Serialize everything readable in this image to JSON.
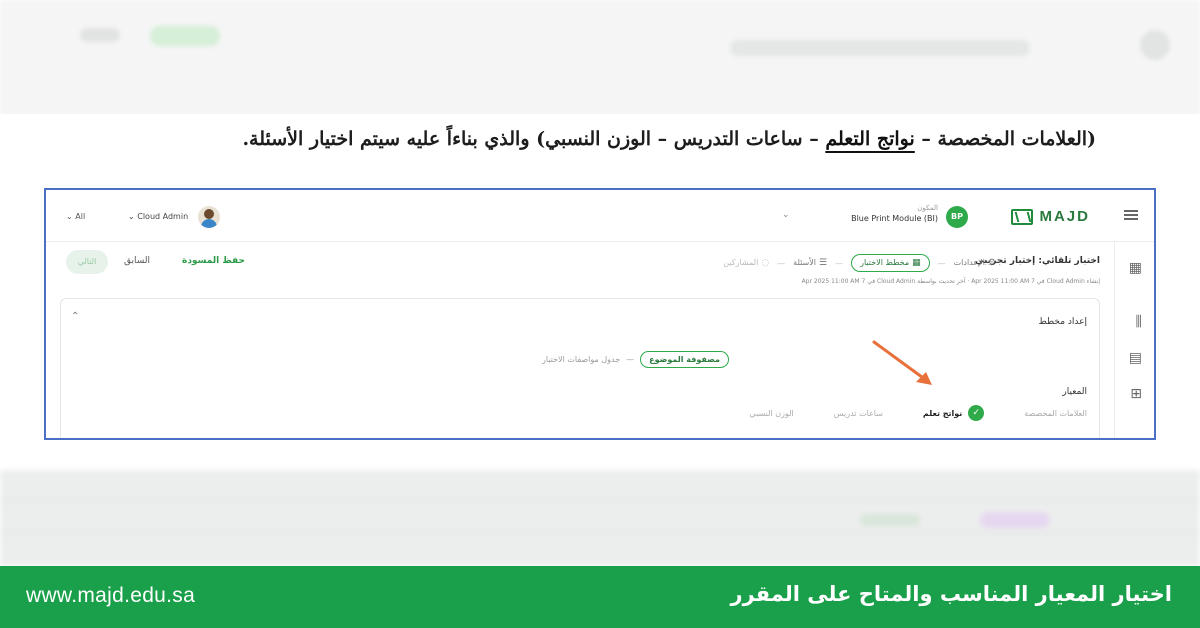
{
  "instruction": {
    "open": "(العلامات المخصصة – ",
    "highlight": "نواتج التعلم",
    "rest": " – ساعات التدريس – الوزن النسبي) والذي بناءاً عليه سيتم اختيار الأسئلة."
  },
  "topbar": {
    "logo_text": "MAJD",
    "module_avatar": "BP",
    "module_label": "المكون",
    "module_value": "Blue Print Module (BI)",
    "user_name": "Cloud Admin",
    "language": "All"
  },
  "exam": {
    "title": "اختبار تلقائي: إختبار تجريبي",
    "steps": [
      {
        "label": "الإعدادات",
        "icon": "gear-icon"
      },
      {
        "label": "مخطط الاختبار",
        "icon": "table-icon"
      },
      {
        "label": "الأسئلة",
        "icon": "list-icon"
      },
      {
        "label": "المشاركين",
        "icon": "users-icon"
      }
    ],
    "meta": "إنشاء Cloud Admin في 7 Apr 2025 11:00 AM · آخر تحديث بواسطة Cloud Admin في 7 Apr 2025 11:00 AM",
    "btn_draft": "حفظ المسودة",
    "btn_prev": "السابق",
    "btn_next": "التالي"
  },
  "card": {
    "title": "إعداد مخطط",
    "subtabs": [
      "مصفوفة الموضوع",
      "جدول مواصفات الاختبار"
    ],
    "criteria_label": "المعيار",
    "criteria": [
      {
        "label": "العلامات المخصصة",
        "active": false
      },
      {
        "label": "نواتج تعلم",
        "active": true
      },
      {
        "label": "ساعات تدريس",
        "active": false
      },
      {
        "label": "الوزن النسبي",
        "active": false
      }
    ]
  },
  "footer": {
    "url": "www.majd.edu.sa",
    "title": "اختيار المعيار المناسب والمتاح على المقرر"
  },
  "colors": {
    "accent_green": "#1aa04b",
    "frame_blue": "#4a6fc4",
    "arrow_orange": "#e8703a"
  }
}
